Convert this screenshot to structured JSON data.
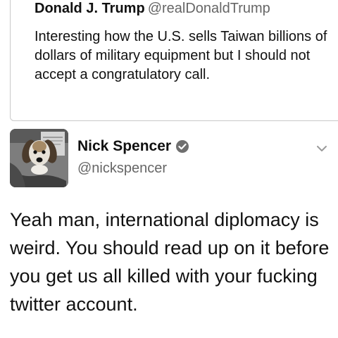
{
  "quoted_tweet": {
    "author_name": "Donald J. Trump",
    "author_handle": "@realDonaldTrump",
    "text": "Interesting how the U.S. sells Taiwan billions of dollars of military equipment but I should not accept a congratulatory call."
  },
  "tweet": {
    "author_name": "Nick Spencer",
    "author_handle": "@nickspencer",
    "verified": true,
    "text": "Yeah man, international diplomacy is weird. You should read up on it before you get us all killed with your fucking twitter account.",
    "avatar_icon": "beagle-avatar",
    "menu_icon": "chevron-down-icon"
  }
}
